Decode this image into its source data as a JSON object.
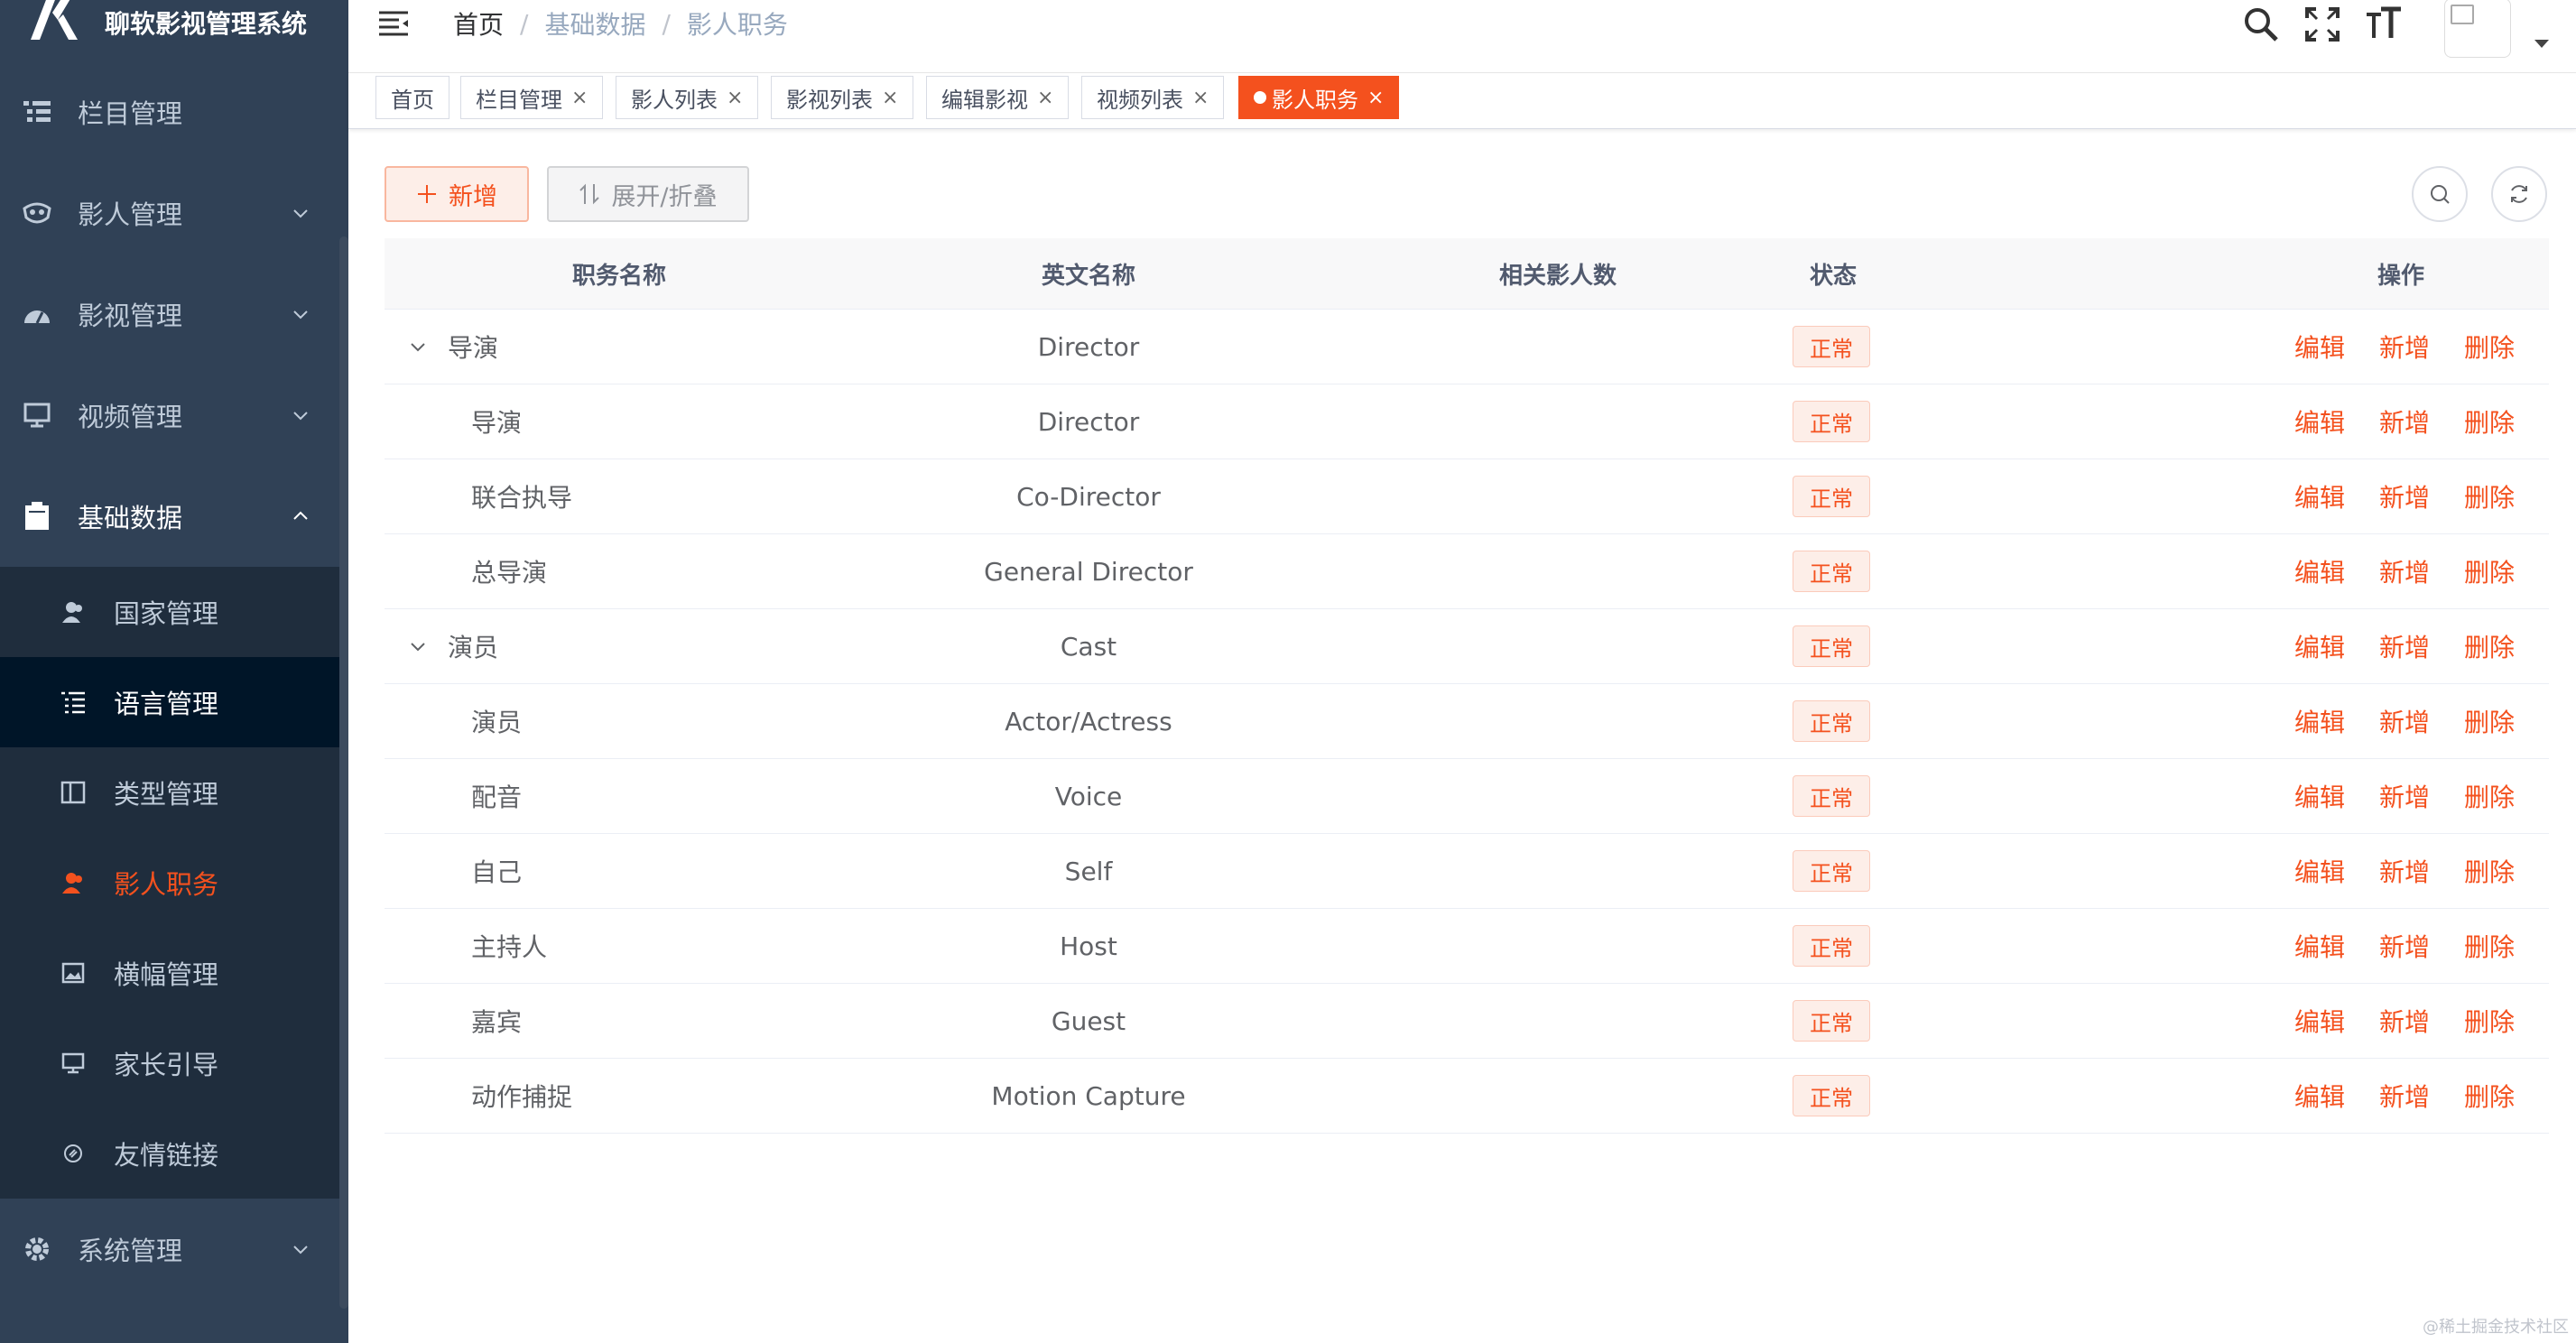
{
  "app": {
    "title": "聊软影视管理系统"
  },
  "sidebar": {
    "items": [
      {
        "label": "栏目管理",
        "icon": "tree-table-icon",
        "has_children": false
      },
      {
        "label": "影人管理",
        "icon": "mask-icon",
        "has_children": true
      },
      {
        "label": "影视管理",
        "icon": "dashboard-icon",
        "has_children": true
      },
      {
        "label": "视频管理",
        "icon": "monitor-icon",
        "has_children": true
      },
      {
        "label": "基础数据",
        "icon": "clipboard-icon",
        "has_children": true,
        "expanded": true
      }
    ],
    "sub_items": [
      {
        "label": "国家管理",
        "icon": "peoples-icon"
      },
      {
        "label": "语言管理",
        "icon": "list-icon"
      },
      {
        "label": "类型管理",
        "icon": "columns-icon"
      },
      {
        "label": "影人职务",
        "icon": "peoples-icon",
        "active": true
      },
      {
        "label": "横幅管理",
        "icon": "image-icon"
      },
      {
        "label": "家长引导",
        "icon": "screen-icon"
      },
      {
        "label": "友情链接",
        "icon": "link-icon"
      }
    ],
    "bottom_item": {
      "label": "系统管理",
      "icon": "gear-icon"
    }
  },
  "breadcrumb": [
    "首页",
    "基础数据",
    "影人职务"
  ],
  "tags": [
    {
      "label": "首页",
      "closable": false
    },
    {
      "label": "栏目管理",
      "closable": true
    },
    {
      "label": "影人列表",
      "closable": true
    },
    {
      "label": "影视列表",
      "closable": true
    },
    {
      "label": "编辑影视",
      "closable": true
    },
    {
      "label": "视频列表",
      "closable": true
    },
    {
      "label": "影人职务",
      "closable": true,
      "active": true
    }
  ],
  "toolbar": {
    "add_label": "新增",
    "toggle_label": "展开/折叠",
    "close_glyph": "×"
  },
  "table": {
    "headers": [
      "职务名称",
      "英文名称",
      "相关影人数",
      "状态",
      "操作"
    ],
    "rows": [
      {
        "name": "导演",
        "en": "Director",
        "count": "",
        "status": "正常",
        "level": 0,
        "expanded": true
      },
      {
        "name": "导演",
        "en": "Director",
        "count": "",
        "status": "正常",
        "level": 1
      },
      {
        "name": "联合执导",
        "en": "Co-Director",
        "count": "",
        "status": "正常",
        "level": 1
      },
      {
        "name": "总导演",
        "en": "General Director",
        "count": "",
        "status": "正常",
        "level": 1
      },
      {
        "name": "演员",
        "en": "Cast",
        "count": "",
        "status": "正常",
        "level": 0,
        "expanded": true
      },
      {
        "name": "演员",
        "en": "Actor/Actress",
        "count": "",
        "status": "正常",
        "level": 1
      },
      {
        "name": "配音",
        "en": "Voice",
        "count": "",
        "status": "正常",
        "level": 1
      },
      {
        "name": "自己",
        "en": "Self",
        "count": "",
        "status": "正常",
        "level": 1
      },
      {
        "name": "主持人",
        "en": "Host",
        "count": "",
        "status": "正常",
        "level": 1
      },
      {
        "name": "嘉宾",
        "en": "Guest",
        "count": "",
        "status": "正常",
        "level": 1
      },
      {
        "name": "动作捕捉",
        "en": "Motion Capture",
        "count": "",
        "status": "正常",
        "level": 1
      }
    ],
    "actions": [
      "编辑",
      "新增",
      "删除"
    ]
  },
  "watermark": "@稀土掘金技术社区",
  "colors": {
    "accent": "#f4511e",
    "sidebar_bg": "#304156",
    "submenu_bg": "#1f2d3d"
  }
}
